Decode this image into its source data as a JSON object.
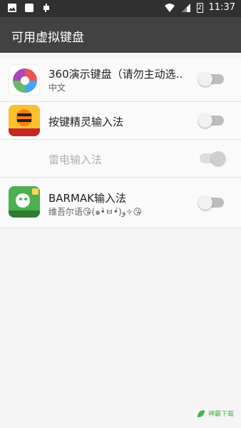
{
  "status_bar": {
    "time": "11:37",
    "battery_level": "2",
    "left_icons": [
      "image-icon",
      "square-icon",
      "debug-icon"
    ],
    "right_icons": [
      "wifi-icon",
      "signal-icon",
      "battery-icon"
    ]
  },
  "appbar": {
    "title": "可用虚拟键盘"
  },
  "keyboards": [
    {
      "title": "360演示键盘（请勿主动选..",
      "subtitle": "中文",
      "enabled": false,
      "icon": "360-keyboard-icon"
    },
    {
      "title": "按键精灵输入法",
      "subtitle": "",
      "enabled": false,
      "icon": "bee-keyboard-icon",
      "icon_caption": "自己录脚本"
    },
    {
      "title": "雷电输入法",
      "subtitle": "",
      "enabled": true,
      "disabled": true,
      "icon": ""
    },
    {
      "title": "BARMAK输入法",
      "subtitle": "维吾尔语😘(๑•̀ㅂ•́)و✧😘",
      "enabled": false,
      "icon": "barmak-keyboard-icon",
      "icon_caption": "BARMAK"
    }
  ],
  "watermark": {
    "text": "神霸下载"
  },
  "colors": {
    "status_bar": "#303030",
    "appbar": "#424242",
    "accent": "#4caf50"
  }
}
